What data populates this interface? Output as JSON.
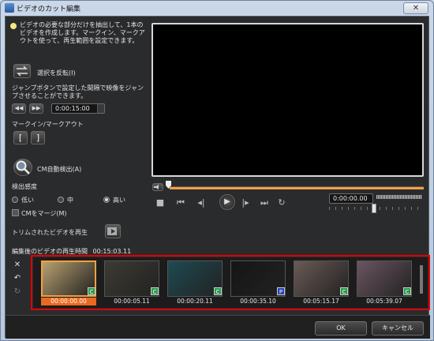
{
  "window": {
    "title": "ビデオのカット編集",
    "close_icon": "close-icon"
  },
  "info": {
    "text": "ビデオの必要な部分だけを抽出して、1本のビデオを作成します。マークイン、マークアウトを使って、再生範囲を設定できます。"
  },
  "select_invert": {
    "label": "選択を反転(I)"
  },
  "jump": {
    "description": "ジャンプボタンで設定した間隔で映像をジャンプさせることができます。",
    "interval": "0:00:15:00"
  },
  "mark": {
    "label": "マークイン/マークアウト"
  },
  "cm_detect": {
    "label": "CM自動検出(A)"
  },
  "sensitivity": {
    "label": "検出感度",
    "options": [
      "低い",
      "中",
      "高い"
    ],
    "selected": "高い"
  },
  "cm_merge": {
    "label": "CMをマージ(M)",
    "checked": false
  },
  "trim_play": {
    "label": "トリムされたビデオを再生"
  },
  "duration": {
    "label": "編集後のビデオの再生時間",
    "value": "00:15:03.11"
  },
  "player": {
    "timecode": "0:00:00.00",
    "progress": 0.02,
    "zoom_level": 0.47
  },
  "clips": [
    {
      "time": "00:00:00.00",
      "badge": "C",
      "selected": true,
      "color": "#b8a070"
    },
    {
      "time": "00:00:05.11",
      "badge": "C",
      "selected": false,
      "color": "#3d3a32"
    },
    {
      "time": "00:00:20.11",
      "badge": "C",
      "selected": false,
      "color": "#1d4a52"
    },
    {
      "time": "00:00:35.10",
      "badge": "P",
      "selected": false,
      "color": "#151515"
    },
    {
      "time": "00:05:15.17",
      "badge": "C",
      "selected": false,
      "color": "#6a5a55"
    },
    {
      "time": "00:05:39.07",
      "badge": "C",
      "selected": false,
      "color": "#6a5560"
    }
  ],
  "buttons": {
    "ok": "OK",
    "cancel": "キャンセル"
  }
}
